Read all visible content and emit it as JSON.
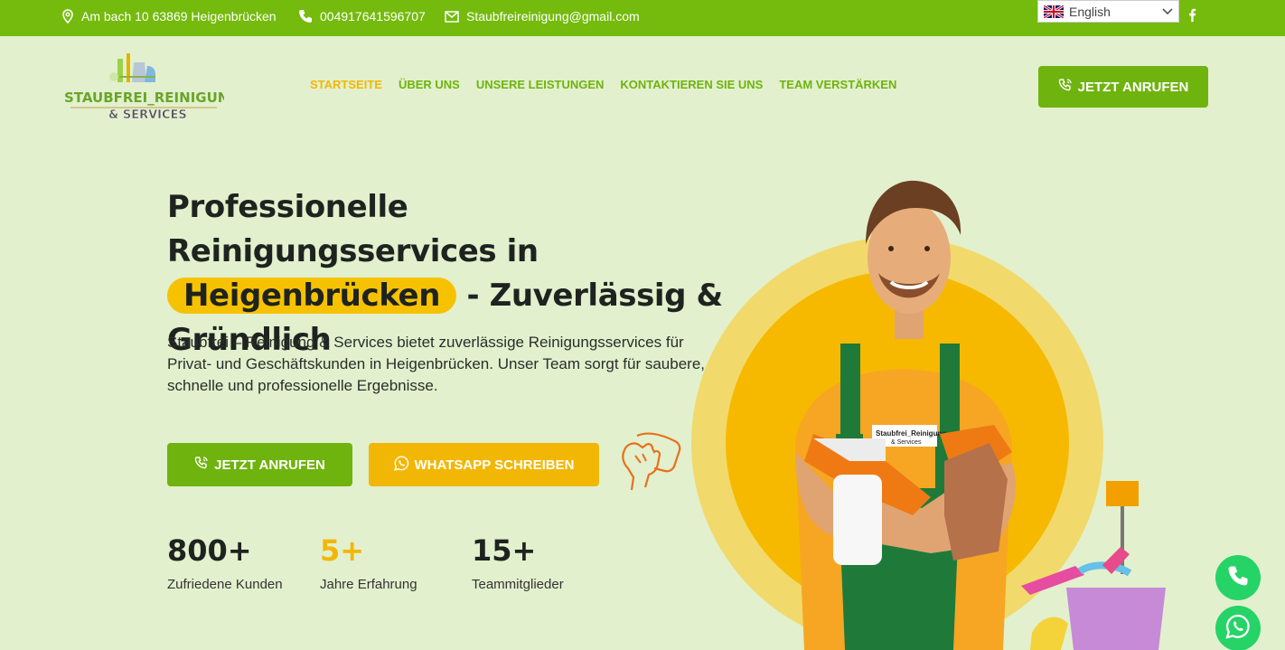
{
  "topbar": {
    "address": "Am bach 10 63869 Heigenbrücken",
    "phone": "004917641596707",
    "email": "Staubfreireinigung@gmail.com",
    "language": "English"
  },
  "logo": {
    "line1": "STAUBFREI_REINIGUNG",
    "line2": "& SERVICES"
  },
  "nav": [
    {
      "label": "STARTSEITE"
    },
    {
      "label": "ÜBER UNS"
    },
    {
      "label": "UNSERE LEISTUNGEN"
    },
    {
      "label": "KONTAKTIEREN SIE UNS"
    },
    {
      "label": "TEAM VERSTÄRKEN"
    }
  ],
  "header_cta": "JETZT ANRUFEN",
  "hero": {
    "title_prefix": "Professionelle Reinigungsservices in",
    "title_highlight": "Heigenbrücken",
    "title_suffix": "- Zuverlässig & Gründlich",
    "text": "Staubfrei – Reinigung & Services bietet zuverlässige Reinigungsservices für Privat- und Geschäftskunden in Heigenbrücken. Unser Team sorgt für saubere, schnelle und professionelle Ergebnisse.",
    "call_button": "JETZT ANRUFEN",
    "whatsapp_button": "WHATSAPP SCHREIBEN"
  },
  "stats": [
    {
      "number": "800+",
      "label": "Zufriedene Kunden"
    },
    {
      "number": "5+",
      "label": "Jahre Erfahrung"
    },
    {
      "number": "15+",
      "label": "Teammitglieder"
    }
  ],
  "badge": {
    "line1": "Staubfrei_Reinigung",
    "line2": "& Services"
  },
  "colors": {
    "green": "#74bb0d",
    "yellow": "#f2b705",
    "bg": "#e2f0cd",
    "whatsapp": "#25d366"
  },
  "icons": [
    "location-icon",
    "phone-icon",
    "email-icon",
    "uk-flag-icon",
    "facebook-icon",
    "whatsapp-icon",
    "cleaning-hand-icon"
  ]
}
